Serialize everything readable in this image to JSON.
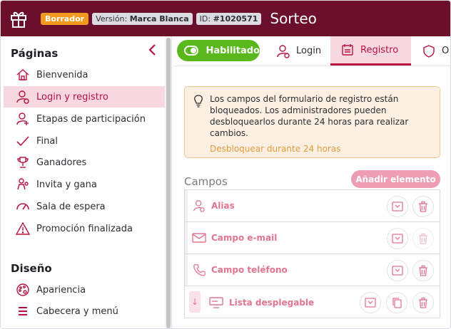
{
  "header": {
    "title": "Sorteo",
    "status_badge": "Borrador",
    "version_prefix": "Versión:",
    "version_value": "Marca Blanca",
    "id_prefix": "ID:",
    "id_value": "#1020571"
  },
  "sidebar": {
    "pages_title": "Páginas",
    "design_title": "Diseño",
    "pages": [
      {
        "label": "Bienvenida",
        "icon": "home-icon"
      },
      {
        "label": "Login y registro",
        "icon": "user-login-icon"
      },
      {
        "label": "Etapas de participación",
        "icon": "user-add-icon"
      },
      {
        "label": "Final",
        "icon": "check-icon"
      },
      {
        "label": "Ganadores",
        "icon": "trophy-icon"
      },
      {
        "label": "Invita y gana",
        "icon": "invite-icon"
      },
      {
        "label": "Sala de espera",
        "icon": "gauge-icon"
      },
      {
        "label": "Promoción finalizada",
        "icon": "warning-icon"
      }
    ],
    "design": [
      {
        "label": "Apariencia",
        "icon": "palette-icon"
      },
      {
        "label": "Cabecera y menú",
        "icon": "menu-icon"
      }
    ]
  },
  "tabs": {
    "toggle_label": "Habilitado",
    "items": [
      {
        "label": "Login",
        "icon": "user-login-icon"
      },
      {
        "label": "Registro",
        "icon": "form-icon"
      },
      {
        "label": "O",
        "icon": "shield-icon"
      }
    ]
  },
  "alert": {
    "message": "Los campos del formulario de registro están bloqueados. Los administradores pueden desbloquearlos durante 24 horas para realizar cambios.",
    "link": "Desbloquear durante 24 horas"
  },
  "fields": {
    "title": "Campos",
    "add_button": "Añadir elemento",
    "items": [
      {
        "label": "Alias",
        "icon": "user-icon"
      },
      {
        "label": "Campo e-mail",
        "icon": "mail-icon"
      },
      {
        "label": "Campo teléfono",
        "icon": "phone-icon"
      },
      {
        "label": "Lista desplegable",
        "icon": "dropdown-icon"
      }
    ]
  },
  "colors": {
    "topbar": "#6b0f2a",
    "accent": "#b8133f",
    "toggle": "#58b81c",
    "draft": "#f29a1f"
  }
}
